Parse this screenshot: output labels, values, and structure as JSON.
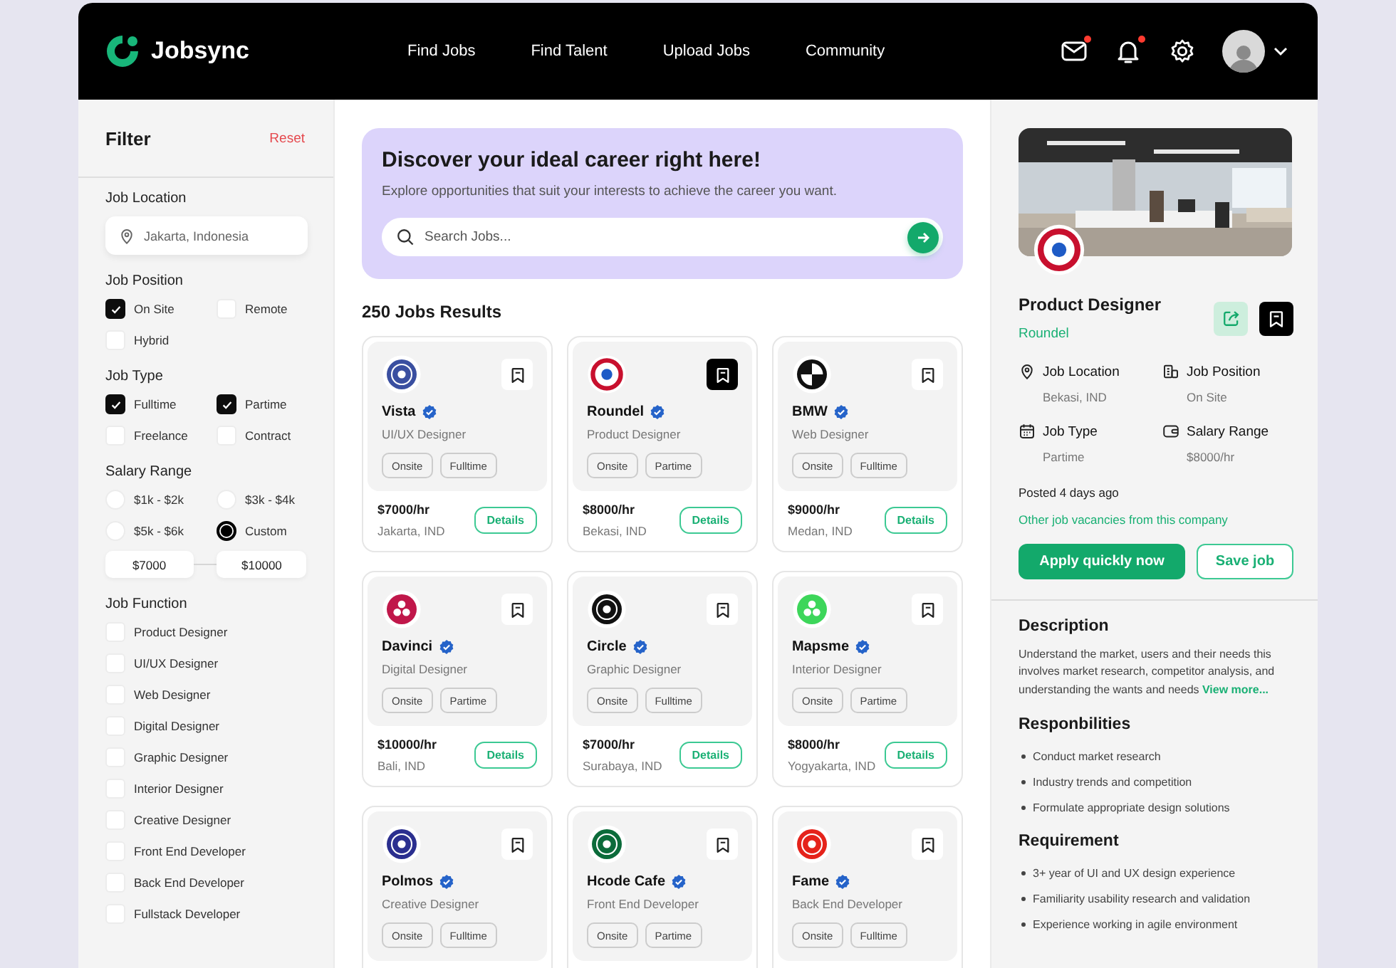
{
  "header": {
    "brand": "Jobsync",
    "nav": [
      "Find Jobs",
      "Find Talent",
      "Upload Jobs",
      "Community"
    ],
    "actions": [
      {
        "kind": "mail",
        "unread": true
      },
      {
        "kind": "bell",
        "unread": true
      },
      {
        "kind": "settings",
        "unread": false
      }
    ]
  },
  "filter": {
    "title": "Filter",
    "reset": "Reset",
    "location": {
      "label": "Job Location",
      "placeholder": "Jakarta, Indonesia"
    },
    "groups": [
      {
        "kind": "checks",
        "label": "Job Position",
        "options": [
          {
            "label": "On Site",
            "checked": true
          },
          {
            "label": "Remote",
            "checked": false
          },
          {
            "label": "Hybrid",
            "checked": false
          }
        ]
      },
      {
        "kind": "checks",
        "label": "Job Type",
        "options": [
          {
            "label": "Fulltime",
            "checked": true
          },
          {
            "label": "Partime",
            "checked": true
          },
          {
            "label": "Freelance",
            "checked": false
          },
          {
            "label": "Contract",
            "checked": false
          }
        ]
      },
      {
        "kind": "radios",
        "label": "Salary Range",
        "options": [
          {
            "label": "$1k - $2k",
            "selected": false
          },
          {
            "label": "$3k - $4k",
            "selected": false
          },
          {
            "label": "$5k - $6k",
            "selected": false
          },
          {
            "label": "Custom",
            "selected": true
          }
        ],
        "min": "$7000",
        "max": "$10000"
      },
      {
        "kind": "list",
        "label": "Job Function",
        "options": [
          {
            "label": "Product Designer",
            "checked": false
          },
          {
            "label": "UI/UX Designer",
            "checked": false
          },
          {
            "label": "Web Designer",
            "checked": false
          },
          {
            "label": "Digital Designer",
            "checked": false
          },
          {
            "label": "Graphic Designer",
            "checked": false
          },
          {
            "label": "Interior Designer",
            "checked": false
          },
          {
            "label": "Creative Designer",
            "checked": false
          },
          {
            "label": "Front End Developer",
            "checked": false
          },
          {
            "label": "Back End Developer",
            "checked": false
          },
          {
            "label": "Fullstack Developer",
            "checked": false
          }
        ]
      }
    ]
  },
  "hero": {
    "title": "Discover your ideal career right here!",
    "subtitle": "Explore opportunities that suit your interests to achieve the career you want.",
    "search": {
      "placeholder": "Search Jobs..."
    }
  },
  "results": "250 Jobs Results",
  "jobs": [
    {
      "company": "Vista",
      "verified": true,
      "role": "UI/UX Designer",
      "tags": [
        "Onsite",
        "Fulltime"
      ],
      "pay": "$7000/hr",
      "location": "Jakarta, IND",
      "action": "Details",
      "saved": false,
      "logo": {
        "kind": "seal",
        "color": "#3a4fa0"
      }
    },
    {
      "company": "Roundel",
      "verified": true,
      "role": "Product Designer",
      "tags": [
        "Onsite",
        "Partime"
      ],
      "pay": "$8000/hr",
      "location": "Bekasi, IND",
      "action": "Details",
      "saved": true,
      "logo": {
        "kind": "roundel",
        "color": "#c8102e"
      }
    },
    {
      "company": "BMW",
      "verified": true,
      "role": "Web Designer",
      "tags": [
        "Onsite",
        "Fulltime"
      ],
      "pay": "$9000/hr",
      "location": "Medan, IND",
      "action": "Details",
      "saved": false,
      "logo": {
        "kind": "quad",
        "color": "#111111"
      }
    },
    {
      "company": "Davinci",
      "verified": true,
      "role": "Digital Designer",
      "tags": [
        "Onsite",
        "Partime"
      ],
      "pay": "$10000/hr",
      "location": "Bali, IND",
      "action": "Details",
      "saved": false,
      "logo": {
        "kind": "dots",
        "color": "#c0174a"
      }
    },
    {
      "company": "Circle",
      "verified": true,
      "role": "Graphic Designer",
      "tags": [
        "Onsite",
        "Fulltime"
      ],
      "pay": "$7000/hr",
      "location": "Surabaya, IND",
      "action": "Details",
      "saved": false,
      "logo": {
        "kind": "seal",
        "color": "#111111"
      }
    },
    {
      "company": "Mapsme",
      "verified": true,
      "role": "Interior Designer",
      "tags": [
        "Onsite",
        "Partime"
      ],
      "pay": "$8000/hr",
      "location": "Yogyakarta, IND",
      "action": "Details",
      "saved": false,
      "logo": {
        "kind": "dots",
        "color": "#3dd65a"
      }
    },
    {
      "company": "Polmos",
      "verified": true,
      "role": "Creative Designer",
      "tags": [
        "Onsite",
        "Fulltime"
      ],
      "saved": false,
      "logo": {
        "kind": "seal",
        "color": "#2b2f8f"
      }
    },
    {
      "company": "Hcode Cafe",
      "verified": true,
      "role": "Front End Developer",
      "tags": [
        "Onsite",
        "Partime"
      ],
      "saved": false,
      "logo": {
        "kind": "seal",
        "color": "#0b6b3a"
      }
    },
    {
      "company": "Fame",
      "verified": true,
      "role": "Back End Developer",
      "tags": [
        "Onsite",
        "Fulltime"
      ],
      "saved": false,
      "logo": {
        "kind": "seal",
        "color": "#e5231b"
      }
    }
  ],
  "detail": {
    "title": "Product Designer",
    "company": "Roundel",
    "saved": true,
    "logo": {
      "kind": "roundel",
      "color": "#c8102e"
    },
    "facts": [
      {
        "label": "Job Location",
        "value": "Bekasi, IND"
      },
      {
        "label": "Job Position",
        "value": "On Site"
      },
      {
        "label": "Job Type",
        "value": "Partime"
      },
      {
        "label": "Salary Range",
        "value": "$8000/hr"
      }
    ],
    "posted": "Posted 4 days ago",
    "company_link": "Other job vacancies from this company",
    "apply": "Apply quickly now",
    "save": "Save job",
    "description": {
      "title": "Description",
      "text": "Understand the market, users and their needs this involves market research, competitor analysis, and understanding the wants and needs",
      "link": "View more..."
    },
    "responsibilities": {
      "title": "Responbilities",
      "items": [
        "Conduct market research",
        "Industry trends and competition",
        "Formulate appropriate design solutions"
      ]
    },
    "requirements": {
      "title": "Requirement",
      "items": [
        "3+ year of UI and UX design experience",
        "Familiarity usability research and validation",
        "Experience working in agile environment"
      ]
    }
  }
}
